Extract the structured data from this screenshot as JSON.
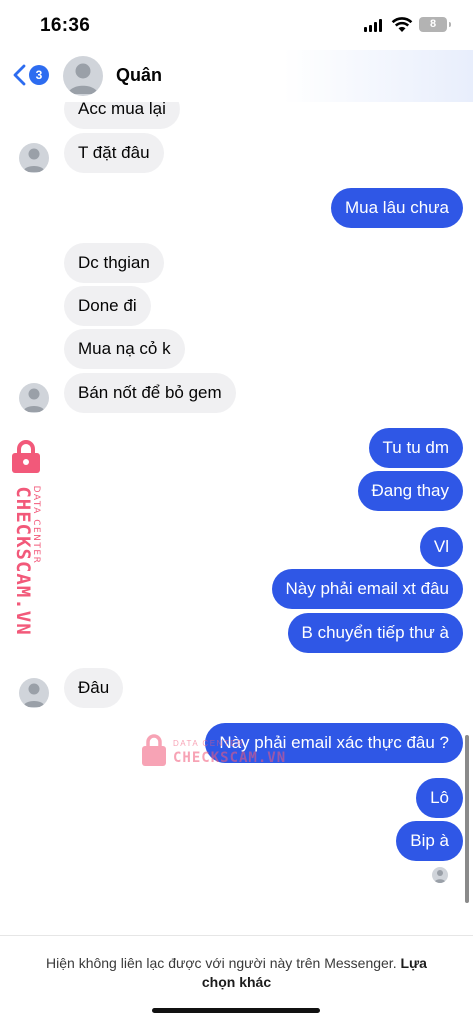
{
  "status_bar": {
    "time": "16:36",
    "battery": "8"
  },
  "header": {
    "back_badge": "3",
    "contact_name": "Quân"
  },
  "messages": {
    "m1": "Acc mua lại",
    "m2": "T đặt đâu",
    "m3": "Mua lâu chưa",
    "m4": "Dc thgian",
    "m5": "Done đi",
    "m6": "Mua nạ cỏ k",
    "m7": "Bán nốt để bỏ gem",
    "m8": "Tu tu dm",
    "m9": "Đang thay",
    "m10": "Vl",
    "m11": "Này phải email xt đâu",
    "m12": "B chuyển tiếp thư à",
    "m13": "Đâu",
    "m14": "Này phải email xác thực đâu ?",
    "m15": "Lô",
    "m16": "Bip à"
  },
  "watermark": {
    "main": "CHECKSCAM.VN",
    "sub": "DATA CENTER"
  },
  "footer": {
    "notice": "Hiện không liên lạc được với người này trên Messenger.",
    "link": "Lựa chọn khác"
  },
  "colors": {
    "outgoing_bubble": "#2f57e6",
    "incoming_bubble": "#f0f0f2",
    "badge": "#2d6cf0",
    "watermark": "#f2597a"
  }
}
